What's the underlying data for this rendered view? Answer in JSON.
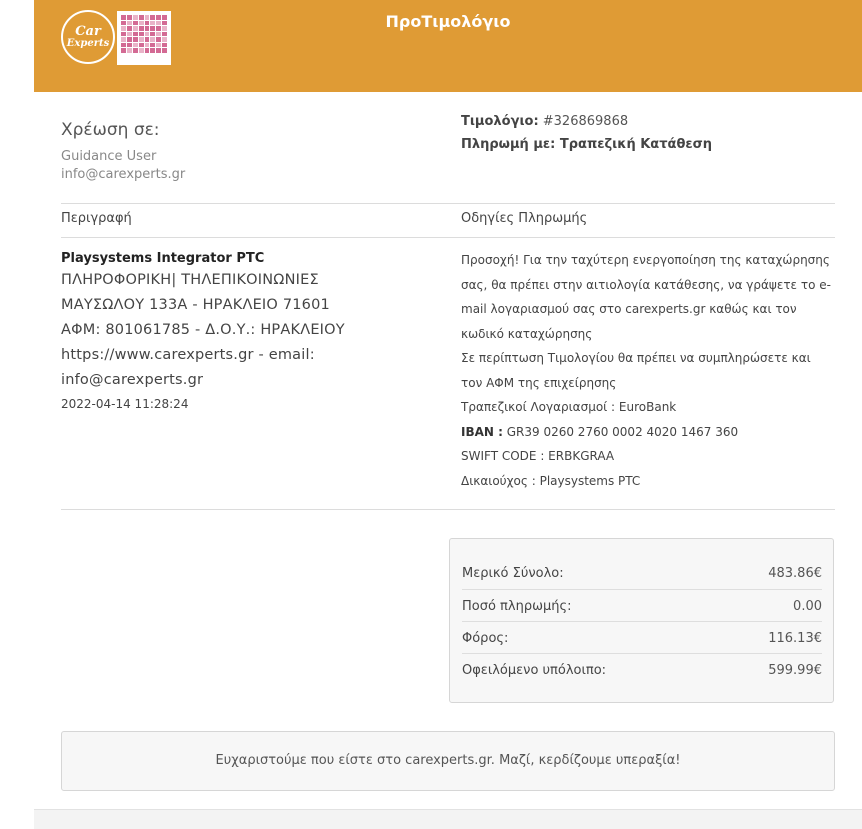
{
  "header": {
    "title": "ΠροΤιμολόγιο",
    "logo_text_line1": "Car",
    "logo_text_line2": "Experts",
    "brand_color": "#df9b35"
  },
  "billing": {
    "label": "Χρέωση σε:",
    "name": "Guidance User",
    "email": "info@carexperts.gr"
  },
  "invoice": {
    "number_label": "Τιμολόγιο:",
    "number_value": " #326869868",
    "payment_label": "Πληρωμή με: Τραπεζική Κατάθεση"
  },
  "columns": {
    "description": "Περιγραφή",
    "payment_instructions": "Οδηγίες Πληρωμής"
  },
  "company": {
    "name": "Playsystems Integrator PTC",
    "line1": "ΠΛΗΡΟΦΟΡΙΚΗ| ΤΗΛΕΠΙΚΟΙΝΩΝΙΕΣ",
    "line2": "ΜΑΥΣΩΛΟΥ 133Α - ΗΡΑΚΛΕΙΟ 71601",
    "line3": "ΑΦΜ: 801061785 - Δ.Ο.Υ.: ΗΡΑΚΛΕΙΟΥ",
    "line4": "https://www.carexperts.gr - email:",
    "line5": "info@carexperts.gr",
    "date": "2022-04-14 11:28:24"
  },
  "instructions": {
    "p1": "Προσοχή! Για την ταχύτερη ενεργοποίηση της καταχώρησης σας, θα πρέπει στην αιτιολογία κατάθεσης, να γράψετε το e-mail λογαριασμού σας στο carexperts.gr καθώς και τον κωδικό καταχώρησης",
    "p2": "Σε περίπτωση Τιμολογίου θα πρέπει να συμπληρώσετε και τον ΑΦΜ της επιχείρησης",
    "bank": "Τραπεζικοί Λογαριασμοί : EuroBank",
    "iban_label": "IBAN :",
    "iban_value": " GR39 0260 2760 0002 4020 1467 360",
    "swift": "SWIFT CODE : ERBKGRAA",
    "beneficiary": "Δικαιούχος : Playsystems PTC"
  },
  "totals": [
    {
      "label": "Μερικό Σύνολο:",
      "value": "483.86€"
    },
    {
      "label": "Ποσό πληρωμής:",
      "value": "0.00"
    },
    {
      "label": "Φόρος:",
      "value": "116.13€"
    },
    {
      "label": "Οφειλόμενο υπόλοιπο:",
      "value": "599.99€"
    }
  ],
  "footer": {
    "thanks": "Ευχαριστούμε που είστε στο carexperts.gr. Μαζί, κερδίζουμε υπεραξία!"
  }
}
